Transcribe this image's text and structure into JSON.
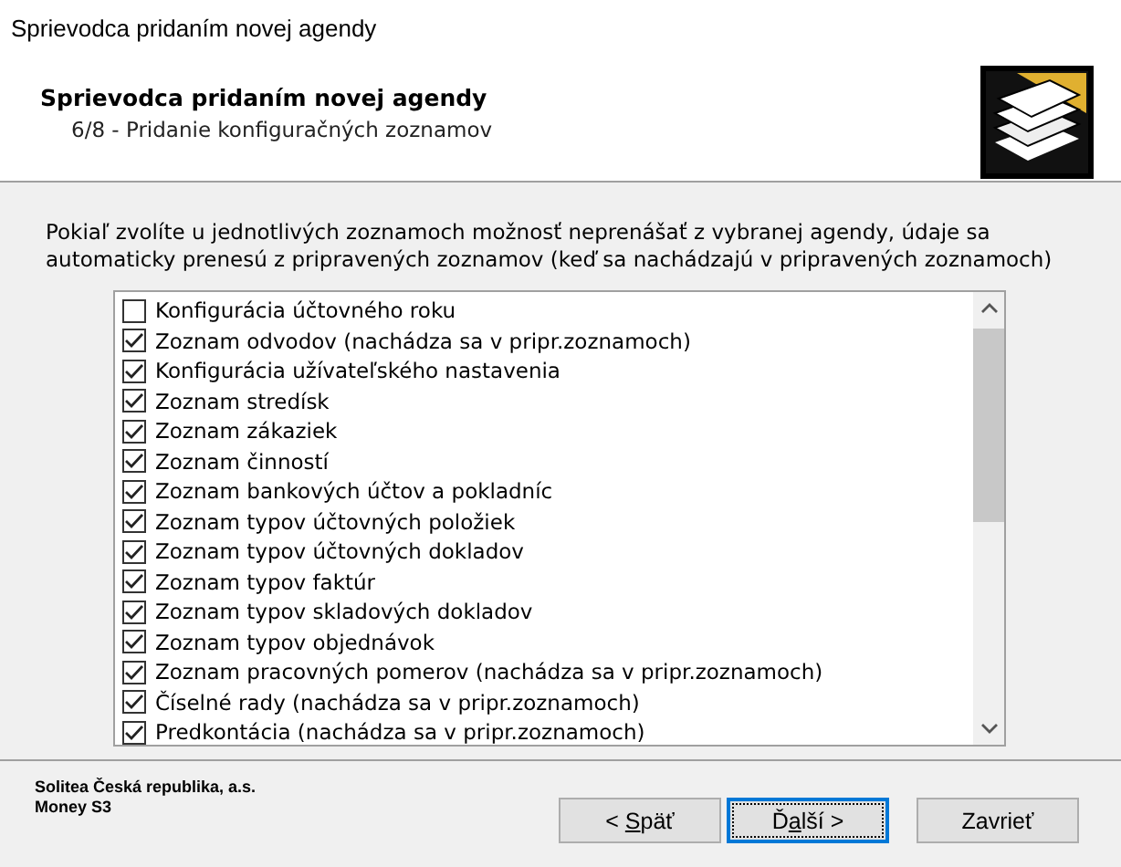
{
  "window": {
    "title": "Sprievodca pridaním novej agendy"
  },
  "header": {
    "title": "Sprievodca pridaním novej agendy",
    "subtitle": "6/8 - Pridanie konfiguračných zoznamov"
  },
  "description": "Pokiaľ zvolíte u jednotlivých zoznamoch možnosť neprenášať z vybranej agendy, údaje sa automaticky prenesú z pripravených zoznamov (keď sa nachádzajú v pripravených zoznamoch)",
  "items": [
    {
      "label": "Konfigurácia účtovného roku",
      "checked": false
    },
    {
      "label": "Zoznam odvodov (nachádza sa v pripr.zoznamoch)",
      "checked": true
    },
    {
      "label": "Konfigurácia užívateľského nastavenia",
      "checked": true
    },
    {
      "label": "Zoznam stredísk",
      "checked": true
    },
    {
      "label": "Zoznam zákaziek",
      "checked": true
    },
    {
      "label": "Zoznam činností",
      "checked": true
    },
    {
      "label": "Zoznam bankových účtov a pokladníc",
      "checked": true
    },
    {
      "label": "Zoznam typov účtovných položiek",
      "checked": true
    },
    {
      "label": "Zoznam typov účtovných dokladov",
      "checked": true
    },
    {
      "label": "Zoznam typov faktúr",
      "checked": true
    },
    {
      "label": "Zoznam typov skladových dokladov",
      "checked": true
    },
    {
      "label": "Zoznam typov objednávok",
      "checked": true
    },
    {
      "label": "Zoznam pracovných pomerov (nachádza sa v pripr.zoznamoch)",
      "checked": true
    },
    {
      "label": "Číselné rady (nachádza sa v pripr.zoznamoch)",
      "checked": true
    },
    {
      "label": "Predkontácia (nachádza sa v pripr.zoznamoch)",
      "checked": true
    }
  ],
  "footer": {
    "company": "Solitea Česká republika, a.s.",
    "product": "Money S3"
  },
  "buttons": [
    {
      "pre": "< ",
      "key": "S",
      "post": "päť",
      "focused": false
    },
    {
      "pre": "Ď",
      "key": "a",
      "post": "lší >",
      "focused": true
    },
    {
      "pre": "Zavrieť",
      "focused": false
    }
  ]
}
